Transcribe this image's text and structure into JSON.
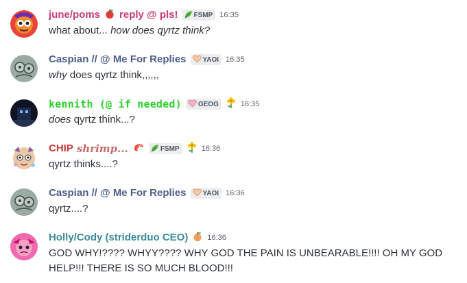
{
  "messages": [
    {
      "author": "june/poms",
      "author_extra": "reply @ pls!",
      "tag": "FSMP",
      "time": "16:35",
      "text_plain": "what about... ",
      "text_italic": "how does qyrtz think?",
      "colors": {
        "name": "#c93a78",
        "extra": "#c93a78"
      },
      "icons": [
        "apple-icon",
        "leaf-icon"
      ]
    },
    {
      "author": "Caspian // @ Me For Replies",
      "tag": "YAOI",
      "time": "16:35",
      "text_italic": "why",
      "text_plain": " does qyrtz think,,,,,,",
      "colors": {
        "name": "#4e5d8a",
        "accent": "#7bb061"
      },
      "icons": [
        "peach-heart-icon"
      ]
    },
    {
      "author": "kennith (@ if needed)",
      "tag": "GEOG",
      "time": "16:35",
      "text_italic": "does",
      "text_plain": " qyrtz think...?",
      "colors": {
        "name": "#2fd12f"
      },
      "icons": [
        "pink-heart-icon",
        "flower-icon"
      ]
    },
    {
      "author": "CHIP",
      "author_extra": "shrimp...",
      "tag": "FSMP",
      "time": "16:36",
      "text_plain": "qyrtz thinks....?",
      "colors": {
        "name": "#c43c3c",
        "extra": "#c46a6a"
      },
      "icons": [
        "shrimp-icon",
        "leaf-icon",
        "flower-icon"
      ]
    },
    {
      "author": "Caspian // @ Me For Replies",
      "tag": "YAOI",
      "time": "16:36",
      "text_plain": "qyrtz....?",
      "colors": {
        "name": "#4e5d8a"
      },
      "icons": [
        "peach-heart-icon"
      ]
    },
    {
      "author": "Holly/Cody (striderduo CEO)",
      "time": "16:36",
      "text_plain": "GOD WHY!???? WHYY???? WHY GOD THE PAIN IS UNBEARABLE!!!! OH MY GOD HELP!!! THERE IS SO MUCH BLOOD!!!",
      "colors": {
        "name": "#3d8a9c"
      },
      "icons": [
        "peach-icon"
      ]
    }
  ]
}
